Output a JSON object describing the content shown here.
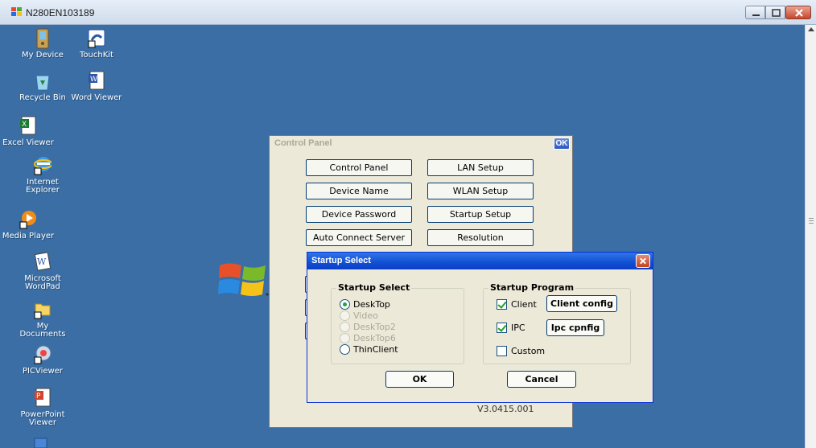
{
  "host_window": {
    "title": "N280EN103189",
    "buttons": [
      "minimize",
      "maximize",
      "close"
    ]
  },
  "desktop": {
    "icons": [
      {
        "label": "My Device",
        "icon": "my-device-icon"
      },
      {
        "label": "TouchKit",
        "icon": "touchkit-icon"
      },
      {
        "label": "Recycle Bin",
        "icon": "recycle-bin-icon"
      },
      {
        "label": "Word Viewer",
        "icon": "word-viewer-icon"
      },
      {
        "label": "Excel Viewer",
        "icon": "excel-viewer-icon"
      },
      {
        "label": "Internet Explorer",
        "icon": "internet-explorer-icon"
      },
      {
        "label": "Media Player",
        "icon": "media-player-icon"
      },
      {
        "label": "Microsoft WordPad",
        "icon": "wordpad-icon"
      },
      {
        "label": "My Documents",
        "icon": "my-documents-icon"
      },
      {
        "label": "PICViewer",
        "icon": "picviewer-icon"
      },
      {
        "label": "PowerPoint Viewer",
        "icon": "powerpoint-viewer-icon"
      }
    ],
    "background_color": "#3a6ea5"
  },
  "control_panel": {
    "title": "Control Panel",
    "ok_label": "OK",
    "buttons_left": [
      "Control Panel",
      "Device Name",
      "Device Password",
      "Auto Connect Server"
    ],
    "buttons_right": [
      "LAN Setup",
      "WLAN Setup",
      "Startup Setup",
      "Resolution"
    ],
    "version": "V3.0415.001"
  },
  "startup_dialog": {
    "title": "Startup Select",
    "startup_select": {
      "title": "Startup Select",
      "options": [
        {
          "label": "DeskTop",
          "checked": true,
          "enabled": true
        },
        {
          "label": "Video",
          "checked": false,
          "enabled": false
        },
        {
          "label": "DeskTop2",
          "checked": false,
          "enabled": false
        },
        {
          "label": "DeskTop6",
          "checked": false,
          "enabled": false
        },
        {
          "label": "ThinClient",
          "checked": false,
          "enabled": true
        }
      ]
    },
    "startup_program": {
      "title": "Startup Program",
      "client_label": "Client",
      "client_checked": true,
      "client_config_label": "Client config",
      "ipc_label": "IPC",
      "ipc_checked": true,
      "ipc_config_label": "Ipc cpnfig",
      "custom_label": "Custom",
      "custom_checked": false
    },
    "ok_label": "OK",
    "cancel_label": "Cancel"
  }
}
